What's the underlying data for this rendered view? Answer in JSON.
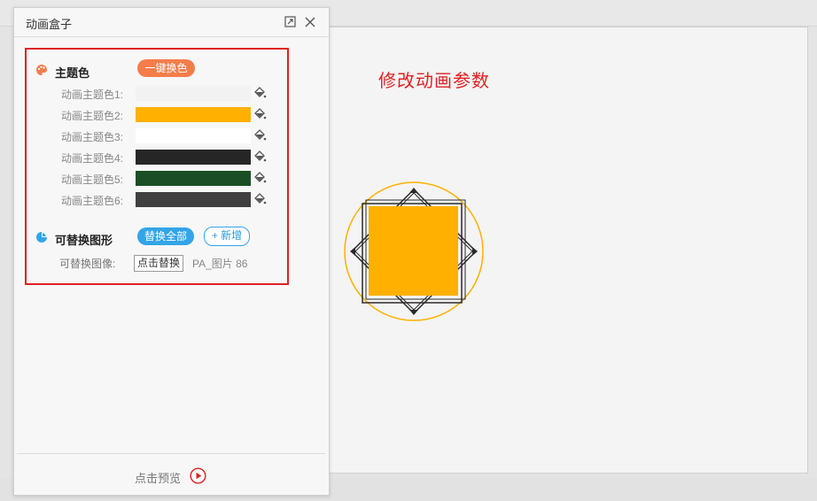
{
  "panel": {
    "title": "动画盒子",
    "restore_icon": "restore-window-icon",
    "close_icon": "close-icon"
  },
  "theme": {
    "title": "主题色",
    "icon": "palette-icon",
    "one_click_button": "一键换色",
    "rows": [
      {
        "label": "动画主题色1:",
        "color": "#f2f2f2"
      },
      {
        "label": "动画主题色2:",
        "color": "#ffb000"
      },
      {
        "label": "动画主题色3:",
        "color": "#ffffff"
      },
      {
        "label": "动画主题色4:",
        "color": "#262626"
      },
      {
        "label": "动画主题色5:",
        "color": "#1a4f25"
      },
      {
        "label": "动画主题色6:",
        "color": "#404040"
      }
    ],
    "bucket_icon": "paint-bucket-icon"
  },
  "replaceable": {
    "title": "可替换图形",
    "icon": "pie-chart-icon",
    "replace_all_button": "替换全部",
    "add_button": "+ 新增",
    "image_label": "可替换图像:",
    "click_replace_button": "点击替换",
    "image_name": "PA_图片 86"
  },
  "footer": {
    "preview_text": "点击预览",
    "play_icon": "play-icon"
  },
  "slide": {
    "annotation": "修改动画参数"
  },
  "colors": {
    "accent_orange": "#f47d4a",
    "accent_blue": "#33a4e8",
    "highlight_red": "#e02020",
    "shape_fill": "#ffb000"
  }
}
